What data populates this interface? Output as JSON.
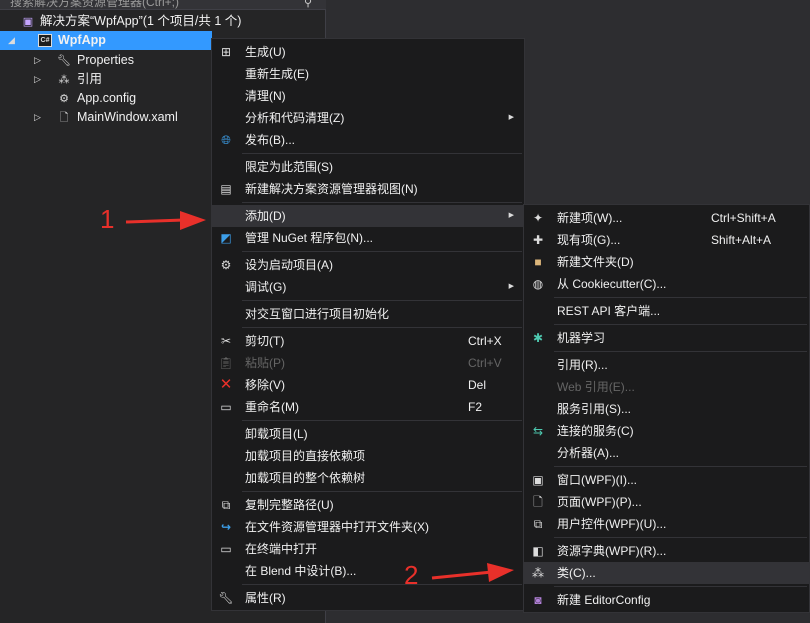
{
  "explorer": {
    "search_placeholder": "搜索解决方案资源管理器(Ctrl+;)",
    "solution_label": "解决方案“WpfApp”(1 个项目/共 1 个)",
    "project_label": "WpfApp",
    "items": [
      {
        "label": "Properties"
      },
      {
        "label": "引用"
      },
      {
        "label": "App.config"
      },
      {
        "label": "MainWindow.xaml"
      }
    ]
  },
  "main_menu": {
    "items": [
      {
        "label": "生成(U)"
      },
      {
        "label": "重新生成(E)"
      },
      {
        "label": "清理(N)"
      },
      {
        "label": "分析和代码清理(Z)"
      },
      {
        "label": "发布(B)..."
      },
      {
        "label": "限定为此范围(S)"
      },
      {
        "label": "新建解决方案资源管理器视图(N)"
      },
      {
        "label": "添加(D)"
      },
      {
        "label": "管理 NuGet 程序包(N)..."
      },
      {
        "label": "设为启动项目(A)"
      },
      {
        "label": "调试(G)"
      },
      {
        "label": "对交互窗口进行项目初始化"
      },
      {
        "label": "剪切(T)",
        "shortcut": "Ctrl+X"
      },
      {
        "label": "粘贴(P)",
        "shortcut": "Ctrl+V"
      },
      {
        "label": "移除(V)",
        "shortcut": "Del"
      },
      {
        "label": "重命名(M)",
        "shortcut": "F2"
      },
      {
        "label": "卸载项目(L)"
      },
      {
        "label": "加载项目的直接依赖项"
      },
      {
        "label": "加载项目的整个依赖树"
      },
      {
        "label": "复制完整路径(U)"
      },
      {
        "label": "在文件资源管理器中打开文件夹(X)"
      },
      {
        "label": "在终端中打开"
      },
      {
        "label": "在 Blend 中设计(B)..."
      },
      {
        "label": "属性(R)"
      }
    ]
  },
  "sub_menu": {
    "items": [
      {
        "label": "新建项(W)...",
        "shortcut": "Ctrl+Shift+A"
      },
      {
        "label": "现有项(G)...",
        "shortcut": "Shift+Alt+A"
      },
      {
        "label": "新建文件夹(D)"
      },
      {
        "label": "从 Cookiecutter(C)..."
      },
      {
        "label": "REST API 客户端..."
      },
      {
        "label": "机器学习"
      },
      {
        "label": "引用(R)..."
      },
      {
        "label": "Web 引用(E)..."
      },
      {
        "label": "服务引用(S)..."
      },
      {
        "label": "连接的服务(C)"
      },
      {
        "label": "分析器(A)..."
      },
      {
        "label": "窗口(WPF)(I)..."
      },
      {
        "label": "页面(WPF)(P)..."
      },
      {
        "label": "用户控件(WPF)(U)..."
      },
      {
        "label": "资源字典(WPF)(R)..."
      },
      {
        "label": "类(C)..."
      },
      {
        "label": "新建 EditorConfig"
      }
    ]
  },
  "annotations": {
    "one": "1",
    "two": "2"
  },
  "colors": {
    "accent": "#3399ff",
    "arrow": "#e8302a",
    "menu_bg": "#1b1b1c",
    "highlight": "#333337"
  }
}
